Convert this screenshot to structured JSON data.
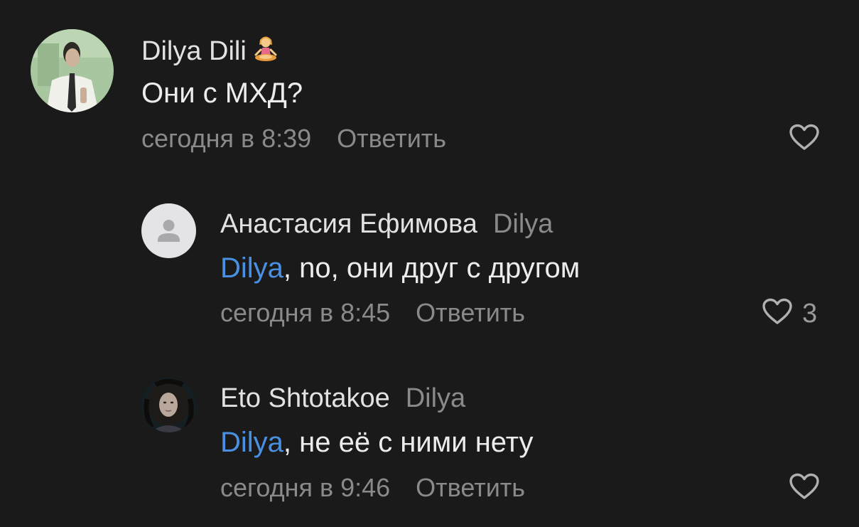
{
  "comments": [
    {
      "author": "Dilya Dili",
      "text": "Они с МХД?",
      "time": "сегодня в 8:39",
      "reply_label": "Ответить",
      "likes": ""
    },
    {
      "author": "Анастасия Ефимова",
      "reply_to": "Dilya",
      "mention": "Dilya",
      "text": ", no, они друг с другом",
      "time": "сегодня в 8:45",
      "reply_label": "Ответить",
      "likes": "3"
    },
    {
      "author": "Eto Shtotakoe",
      "reply_to": "Dilya",
      "mention": "Dilya",
      "text": ", не её с ними нету",
      "time": "сегодня в 9:46",
      "reply_label": "Ответить",
      "likes": ""
    }
  ],
  "icons": {
    "author_badge": "lotus-position-emoji-icon",
    "like": "heart-outline-icon",
    "default_avatar": "user-silhouette-icon"
  },
  "colors": {
    "background": "#1a1a1a",
    "mention": "#4a90e2",
    "secondary_text": "#8a8a8a"
  }
}
